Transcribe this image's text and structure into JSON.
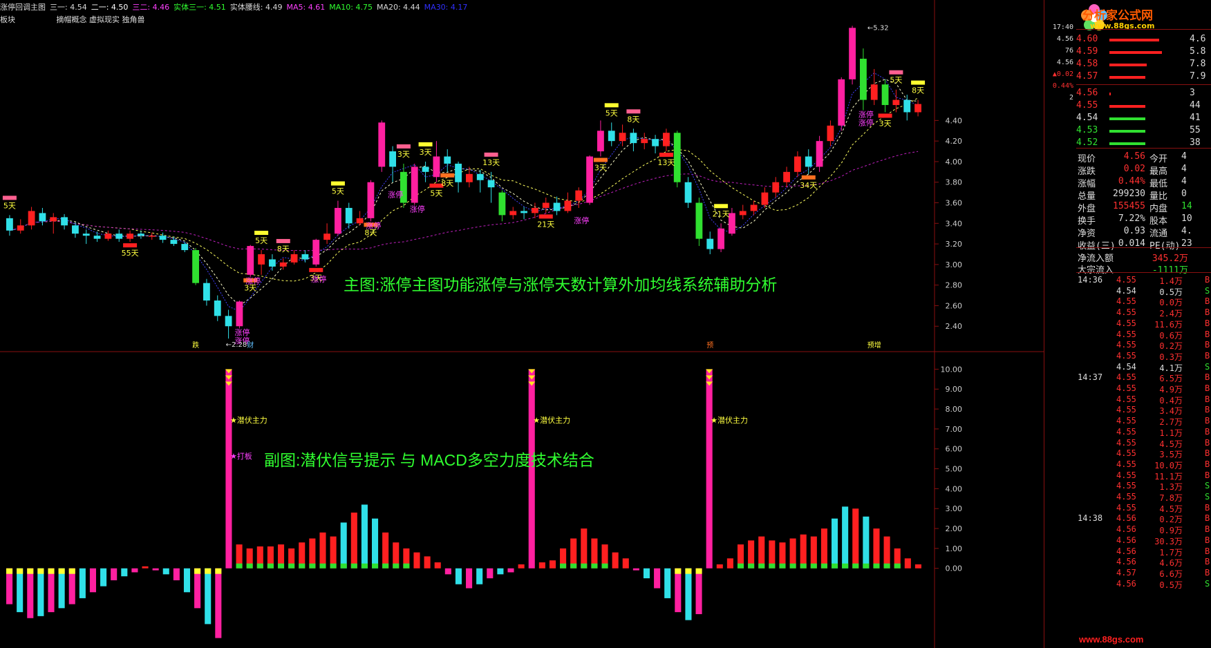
{
  "header": {
    "title": "涨停回调主图",
    "items": [
      {
        "label": "三一: 4.54",
        "color": "#d8d8d8"
      },
      {
        "label": "二一: 4.50",
        "color": "#ffffff"
      },
      {
        "label": "三二: 4.46",
        "color": "#ff40ff"
      },
      {
        "label": "实体三一: 4.51",
        "color": "#30ff30"
      },
      {
        "label": "实体腰线: 4.49",
        "color": "#d8d8d8"
      },
      {
        "label": "MA5: 4.61",
        "color": "#ff40ff"
      },
      {
        "label": "MA10: 4.75",
        "color": "#30ff30"
      },
      {
        "label": "MA20: 4.44",
        "color": "#d8d8d8"
      },
      {
        "label": "MA30: 4.17",
        "color": "#3030ff"
      }
    ],
    "block_label": "板块",
    "concepts": "摘帽概念 虚拟现实 独角兽"
  },
  "captions": {
    "main": "主图:涨停主图功能涨停与涨停天数计算外加均线系统辅助分析",
    "sub": "副图:潜伏信号提示 与 MACD多空力度技术结合"
  },
  "chart_data": [
    {
      "type": "candlestick",
      "y_axis_ticks": [
        "4.40",
        "4.20",
        "4.00",
        "3.80",
        "3.60",
        "3.40",
        "3.20",
        "3.00",
        "2.80",
        "2.60",
        "2.40"
      ],
      "ylim": [
        2.18,
        5.45
      ],
      "high_marker": "5.32",
      "low_marker": "2.28",
      "day_labels": [
        {
          "i": 0,
          "t": "5天"
        },
        {
          "i": 11,
          "t": "55天"
        },
        {
          "i": 23,
          "t": "5天"
        },
        {
          "i": 22,
          "t": "3天"
        },
        {
          "i": 25,
          "t": "8天"
        },
        {
          "i": 28,
          "t": "3天"
        },
        {
          "i": 30,
          "t": "5天"
        },
        {
          "i": 33,
          "t": "8天"
        },
        {
          "i": 36,
          "t": "3天"
        },
        {
          "i": 39,
          "t": "5天"
        },
        {
          "i": 38,
          "t": "3天"
        },
        {
          "i": 40,
          "t": "8天"
        },
        {
          "i": 44,
          "t": "13天"
        },
        {
          "i": 49,
          "t": "21天"
        },
        {
          "i": 55,
          "t": "5天"
        },
        {
          "i": 54,
          "t": "3天"
        },
        {
          "i": 57,
          "t": "8天"
        },
        {
          "i": 60,
          "t": "13天"
        },
        {
          "i": 65,
          "t": "21天"
        },
        {
          "i": 73,
          "t": "34天"
        },
        {
          "i": 81,
          "t": "5天"
        },
        {
          "i": 80,
          "t": "3天"
        },
        {
          "i": 83,
          "t": "8天"
        }
      ],
      "signals": [
        {
          "i": 21,
          "t": "涨停"
        },
        {
          "i": 21,
          "t": "涨停"
        },
        {
          "i": 22,
          "t": "涨停"
        },
        {
          "i": 28,
          "t": "涨停"
        },
        {
          "i": 33,
          "t": "涨停"
        },
        {
          "i": 35,
          "t": "涨停"
        },
        {
          "i": 37,
          "t": "涨停"
        },
        {
          "i": 52,
          "t": "涨停"
        },
        {
          "i": 78,
          "t": "涨停"
        },
        {
          "i": 78,
          "t": "涨停"
        }
      ],
      "bottom_tags": [
        {
          "i": 17,
          "t": "跌"
        },
        {
          "i": 22,
          "t": "财"
        },
        {
          "i": 64,
          "t": "预"
        },
        {
          "i": 79,
          "t": "预增"
        }
      ],
      "candles": [
        [
          3.45,
          3.33,
          3.48,
          3.28
        ],
        [
          3.33,
          3.38,
          3.44,
          3.3
        ],
        [
          3.38,
          3.52,
          3.56,
          3.34
        ],
        [
          3.5,
          3.42,
          3.55,
          3.38
        ],
        [
          3.42,
          3.46,
          3.5,
          3.3
        ],
        [
          3.46,
          3.38,
          3.49,
          3.34
        ],
        [
          3.38,
          3.3,
          3.41,
          3.26
        ],
        [
          3.3,
          3.28,
          3.34,
          3.2
        ],
        [
          3.28,
          3.25,
          3.32,
          3.22
        ],
        [
          3.25,
          3.3,
          3.33,
          3.23
        ],
        [
          3.3,
          3.25,
          3.34,
          3.22
        ],
        [
          3.25,
          3.3,
          3.33,
          3.22
        ],
        [
          3.3,
          3.28,
          3.33,
          3.25
        ],
        [
          3.28,
          3.28,
          3.31,
          3.24
        ],
        [
          3.28,
          3.24,
          3.31,
          3.21
        ],
        [
          3.24,
          3.2,
          3.27,
          3.18
        ],
        [
          3.2,
          3.14,
          3.22,
          3.12
        ],
        [
          3.14,
          2.82,
          3.16,
          2.8
        ],
        [
          2.82,
          2.65,
          2.86,
          2.6
        ],
        [
          2.65,
          2.5,
          2.7,
          2.45
        ],
        [
          2.5,
          2.4,
          2.56,
          2.28
        ],
        [
          2.4,
          2.64,
          2.65,
          2.38
        ],
        [
          2.9,
          3.18,
          3.19,
          2.88
        ],
        [
          3.0,
          3.1,
          3.14,
          2.9
        ],
        [
          3.05,
          2.98,
          3.1,
          2.94
        ],
        [
          2.98,
          3.02,
          3.06,
          2.95
        ],
        [
          3.02,
          3.1,
          3.14,
          3.0
        ],
        [
          3.1,
          3.05,
          3.14,
          3.02
        ],
        [
          3.0,
          3.24,
          3.25,
          2.98
        ],
        [
          3.24,
          3.3,
          3.4,
          3.2
        ],
        [
          3.3,
          3.55,
          3.62,
          3.28
        ],
        [
          3.55,
          3.4,
          3.6,
          3.35
        ],
        [
          3.4,
          3.45,
          3.52,
          3.38
        ],
        [
          3.45,
          3.8,
          3.82,
          3.42
        ],
        [
          3.95,
          4.38,
          4.4,
          3.9
        ],
        [
          4.1,
          3.95,
          4.15,
          3.8
        ],
        [
          3.9,
          3.6,
          3.98,
          3.55
        ],
        [
          3.6,
          3.95,
          3.98,
          3.58
        ],
        [
          3.95,
          3.9,
          4.0,
          3.8
        ],
        [
          3.85,
          4.05,
          4.2,
          3.8
        ],
        [
          4.05,
          3.98,
          4.12,
          3.9
        ],
        [
          3.98,
          3.8,
          4.0,
          3.7
        ],
        [
          3.8,
          3.88,
          3.95,
          3.75
        ],
        [
          3.88,
          3.82,
          3.92,
          3.7
        ],
        [
          3.82,
          3.75,
          3.9,
          3.6
        ],
        [
          3.7,
          3.48,
          3.72,
          3.42
        ],
        [
          3.48,
          3.52,
          3.56,
          3.44
        ],
        [
          3.52,
          3.5,
          3.56,
          3.44
        ],
        [
          3.5,
          3.55,
          3.6,
          3.45
        ],
        [
          3.55,
          3.6,
          3.65,
          3.5
        ],
        [
          3.6,
          3.52,
          3.66,
          3.48
        ],
        [
          3.52,
          3.62,
          3.7,
          3.5
        ],
        [
          3.62,
          3.72,
          3.75,
          3.55
        ],
        [
          3.6,
          4.05,
          4.06,
          3.58
        ],
        [
          4.1,
          4.3,
          4.4,
          4.05
        ],
        [
          4.3,
          4.2,
          4.38,
          4.15
        ],
        [
          4.2,
          4.28,
          4.36,
          4.15
        ],
        [
          4.28,
          4.18,
          4.32,
          4.1
        ],
        [
          4.18,
          4.22,
          4.28,
          4.12
        ],
        [
          4.22,
          4.15,
          4.26,
          4.08
        ],
        [
          4.15,
          4.28,
          4.32,
          4.1
        ],
        [
          4.28,
          3.8,
          4.3,
          3.75
        ],
        [
          3.8,
          3.6,
          3.85,
          3.55
        ],
        [
          3.6,
          3.25,
          3.65,
          3.18
        ],
        [
          3.25,
          3.15,
          3.32,
          3.1
        ],
        [
          3.15,
          3.35,
          3.4,
          3.12
        ],
        [
          3.3,
          3.5,
          3.55,
          3.28
        ],
        [
          3.48,
          3.52,
          3.58,
          3.44
        ],
        [
          3.52,
          3.58,
          3.62,
          3.48
        ],
        [
          3.58,
          3.7,
          3.75,
          3.55
        ],
        [
          3.7,
          3.8,
          3.85,
          3.65
        ],
        [
          3.8,
          3.9,
          3.95,
          3.75
        ],
        [
          3.9,
          4.05,
          4.1,
          3.85
        ],
        [
          4.05,
          3.95,
          4.12,
          3.88
        ],
        [
          3.95,
          4.2,
          4.25,
          3.9
        ],
        [
          4.2,
          4.35,
          4.4,
          4.15
        ],
        [
          4.35,
          4.8,
          4.82,
          4.3
        ],
        [
          4.8,
          5.3,
          5.32,
          4.75
        ],
        [
          5.0,
          4.6,
          5.1,
          4.5
        ],
        [
          4.6,
          4.75,
          4.9,
          4.55
        ],
        [
          4.75,
          4.55,
          4.8,
          4.48
        ],
        [
          4.55,
          4.6,
          4.7,
          4.48
        ],
        [
          4.6,
          4.48,
          4.65,
          4.4
        ],
        [
          4.48,
          4.56,
          4.6,
          4.44
        ]
      ]
    },
    {
      "type": "bar",
      "y_axis_ticks": [
        "10.00",
        "9.00",
        "8.00",
        "7.00",
        "6.00",
        "5.00",
        "4.00",
        "3.00",
        "2.00",
        "1.00",
        "0.00"
      ],
      "ylim": [
        -4.0,
        10.5
      ],
      "markers": [
        {
          "i": 21,
          "label": "★潜伏主力"
        },
        {
          "i": 21,
          "label": "★打板"
        },
        {
          "i": 50,
          "label": "★潜伏主力"
        },
        {
          "i": 67,
          "label": "★潜伏主力"
        }
      ],
      "values": [
        -1.8,
        -2.2,
        -2.5,
        -2.4,
        -2.2,
        -2.0,
        -1.8,
        -1.5,
        -1.2,
        -0.9,
        -0.6,
        -0.4,
        -0.2,
        0.1,
        -0.1,
        -0.3,
        -0.6,
        -1.2,
        -2.0,
        -2.8,
        -3.5,
        10.0,
        1.2,
        1.0,
        1.1,
        1.1,
        1.2,
        1.0,
        1.3,
        1.5,
        1.8,
        1.6,
        2.3,
        2.8,
        3.2,
        2.5,
        1.8,
        1.3,
        1.0,
        0.8,
        0.6,
        0.3,
        -0.3,
        -0.8,
        -1.0,
        -0.8,
        -0.5,
        -0.3,
        -0.2,
        0.2,
        10.0,
        0.3,
        0.4,
        1.0,
        1.5,
        2.0,
        1.5,
        1.2,
        0.8,
        0.5,
        -0.1,
        -0.5,
        -1.0,
        -1.5,
        -2.2,
        -2.6,
        -2.3,
        10.0,
        0.2,
        0.5,
        1.2,
        1.4,
        1.6,
        1.4,
        1.3,
        1.5,
        1.7,
        1.6,
        2.0,
        2.5,
        3.1,
        3.0,
        2.6,
        2.0,
        1.6,
        1.0,
        0.5,
        0.2
      ]
    }
  ],
  "side": {
    "logo_text": "分析家公式网",
    "logo_url": "www.88gs.com",
    "small_scale": [
      "17:40",
      "4.56",
      "76",
      "4.56",
      "▲0.02",
      "0.44%",
      "2"
    ],
    "asks": [
      {
        "price": "4.60",
        "vol": "4.6"
      },
      {
        "price": "4.59",
        "vol": "5.8"
      },
      {
        "price": "4.58",
        "vol": "7.8"
      },
      {
        "price": "4.57",
        "vol": "7.9"
      }
    ],
    "bids": [
      {
        "price": "4.56",
        "vol": "3"
      },
      {
        "price": "4.55",
        "vol": "44"
      },
      {
        "price": "4.54",
        "vol": "41"
      },
      {
        "price": "4.53",
        "vol": "55"
      },
      {
        "price": "4.52",
        "vol": "38"
      }
    ],
    "quote": [
      {
        "l1": "现价",
        "v1": "4.56",
        "l2": "今开",
        "v2": "4"
      },
      {
        "l1": "涨跌",
        "v1": "0.02",
        "l2": "最高",
        "v2": "4"
      },
      {
        "l1": "涨幅",
        "v1": "0.44%",
        "l2": "最低",
        "v2": "4"
      },
      {
        "l1": "总量",
        "v1": "299230",
        "l2": "量比",
        "v2": "0"
      },
      {
        "l1": "外盘",
        "v1": "155455",
        "l2": "内盘",
        "v2": "14"
      },
      {
        "l1": "换手",
        "v1": "7.22%",
        "l2": "股本",
        "v2": "10"
      },
      {
        "l1": "净资",
        "v1": "0.93",
        "l2": "流通",
        "v2": "4."
      },
      {
        "l1": "收益(三)",
        "v1": "0.014",
        "l2": "PE(动)",
        "v2": "23"
      }
    ],
    "flows": [
      {
        "label": "净流入额",
        "value": "345.2万"
      },
      {
        "label": "大宗流入",
        "value": "-1111万"
      }
    ],
    "ticks": [
      {
        "time": "14:36",
        "rows": [
          [
            "4.55",
            "1.4万",
            "B"
          ],
          [
            "4.54",
            "0.5万",
            "S"
          ],
          [
            "4.55",
            "0.0万",
            "B"
          ],
          [
            "4.55",
            "2.4万",
            "B"
          ],
          [
            "4.55",
            "11.6万",
            "B"
          ],
          [
            "4.55",
            "0.6万",
            "B"
          ],
          [
            "4.55",
            "0.2万",
            "B"
          ],
          [
            "4.55",
            "0.3万",
            "B"
          ],
          [
            "4.54",
            "4.1万",
            "S"
          ]
        ]
      },
      {
        "time": "14:37",
        "rows": [
          [
            "4.55",
            "6.5万",
            "B"
          ],
          [
            "4.55",
            "4.9万",
            "B"
          ],
          [
            "4.55",
            "0.4万",
            "B"
          ],
          [
            "4.55",
            "3.4万",
            "B"
          ],
          [
            "4.55",
            "2.7万",
            "B"
          ],
          [
            "4.55",
            "1.1万",
            "B"
          ],
          [
            "4.55",
            "4.5万",
            "B"
          ],
          [
            "4.55",
            "3.5万",
            "B"
          ],
          [
            "4.55",
            "10.0万",
            "B"
          ],
          [
            "4.55",
            "11.1万",
            "B"
          ],
          [
            "4.55",
            "1.3万",
            "S"
          ],
          [
            "4.55",
            "7.8万",
            "S"
          ],
          [
            "4.55",
            "4.5万",
            "B"
          ]
        ]
      },
      {
        "time": "14:38",
        "rows": [
          [
            "4.56",
            "0.2万",
            "B"
          ],
          [
            "4.56",
            "0.9万",
            "B"
          ],
          [
            "4.56",
            "30.3万",
            "B"
          ],
          [
            "4.56",
            "1.7万",
            "B"
          ],
          [
            "4.56",
            "4.6万",
            "B"
          ],
          [
            "4.57",
            "6.6万",
            "B"
          ],
          [
            "4.56",
            "0.5万",
            "S"
          ]
        ]
      }
    ],
    "watermark": "www.88gs.com"
  },
  "colors": {
    "up": "#ff2020",
    "down": "#30e0e8",
    "magenta": "#ff20a0",
    "green": "#30e030",
    "yellow": "#ffff30",
    "orange": "#ff7020",
    "pink": "#ff6090",
    "panel_line": "#8a1010",
    "gray": "#aaaaaa"
  }
}
